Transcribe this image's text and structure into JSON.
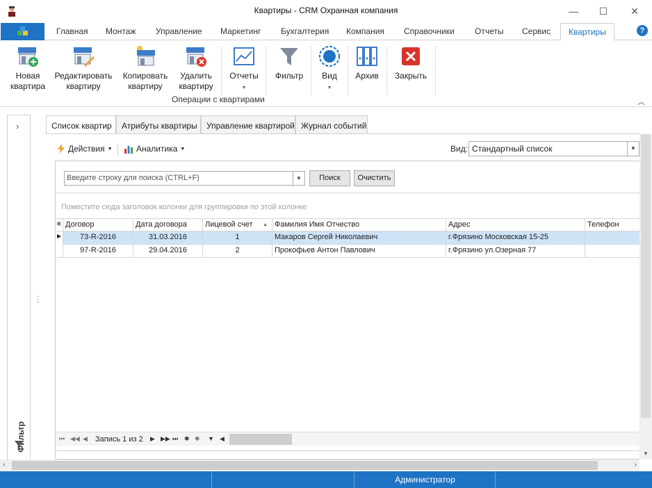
{
  "window": {
    "title": "Квартиры - CRM Охранная компания",
    "minimize": "—",
    "maximize": "☐",
    "close": "✕"
  },
  "ribbon_tabs": [
    "Главная",
    "Монтаж",
    "Управление",
    "Маркетинг",
    "Бухгалтерия",
    "Компания",
    "Справочники",
    "Отчеты",
    "Сервис",
    "Квартиры"
  ],
  "active_ribbon_tab": "Квартиры",
  "ribbon": {
    "buttons": [
      {
        "label": "Новая\nквартира",
        "icon": "store-add-icon"
      },
      {
        "label": "Редактировать\nквартиру",
        "icon": "store-edit-icon"
      },
      {
        "label": "Копировать\nквартиру",
        "icon": "store-copy-icon"
      },
      {
        "label": "Удалить\nквартиру",
        "icon": "store-delete-icon"
      },
      {
        "label": "Отчеты",
        "icon": "chart-icon"
      },
      {
        "label": "Фильтр",
        "icon": "funnel-icon"
      },
      {
        "label": "Вид",
        "icon": "view-icon"
      },
      {
        "label": "Архив",
        "icon": "archive-binders-icon"
      },
      {
        "label": "Закрыть",
        "icon": "close-red-icon"
      }
    ],
    "group_caption": "Операции с квартирами",
    "dropdown_marker": "▼"
  },
  "left_panel": {
    "label": "Фильтр",
    "expand": "›"
  },
  "doc_tabs": [
    "Список квартир",
    "Атрибуты квартиры",
    "Управление квартирой",
    "Журнал событий"
  ],
  "toolbar": {
    "actions": "Действия",
    "analytics": "Аналитика",
    "view_label": "Вид:",
    "view_value": "Стандартный список"
  },
  "search": {
    "placeholder": "Введите строку для поиска (CTRL+F)",
    "search_button": "Поиск",
    "clear_button": "Очистить"
  },
  "group_hint": "Поместите сюда заголовок колонки для группировки по этой колонке",
  "grid": {
    "columns": [
      "Договор",
      "Дата договора",
      "Лицевой счет",
      "Фамилия Имя Отчество",
      "Адрес",
      "Телефон"
    ],
    "rows": [
      {
        "contract": "73-R-2016",
        "date": "31.03.2016",
        "account": "1",
        "name": "Макаров Сергей Николаевич",
        "address": "г.Фрязино Московская 15-25",
        "phone": ""
      },
      {
        "contract": "97-R-2016",
        "date": "29.04.2016",
        "account": "2",
        "name": "Прокофьев Антон Павлович",
        "address": "г.Фрязино ул.Озерная 77",
        "phone": ""
      }
    ],
    "record_nav": "Запись 1 из 2"
  },
  "status": {
    "user": "Администратор"
  },
  "colors": {
    "accent": "#1e73c4",
    "selected_row": "#cde3f6"
  }
}
